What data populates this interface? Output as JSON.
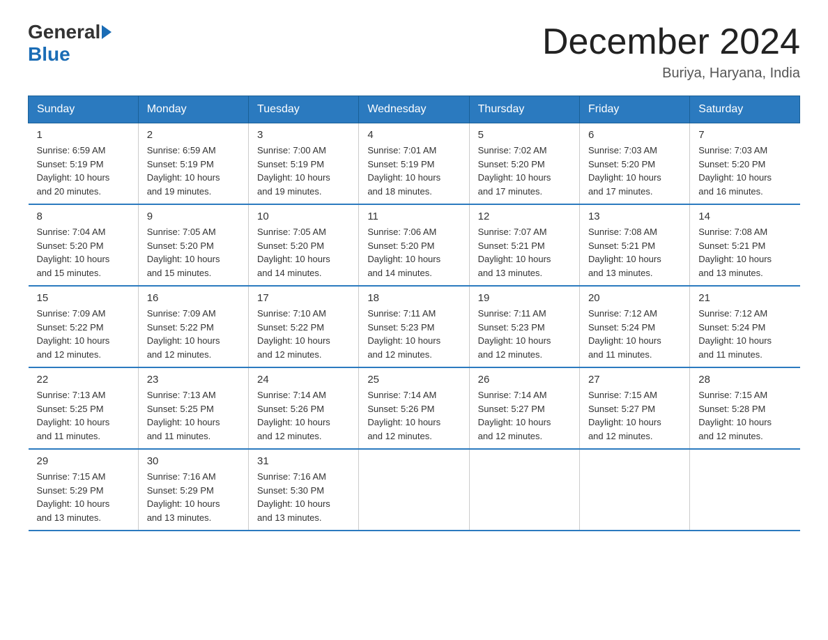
{
  "logo": {
    "general": "General",
    "blue": "Blue"
  },
  "title": "December 2024",
  "location": "Buriya, Haryana, India",
  "days_of_week": [
    "Sunday",
    "Monday",
    "Tuesday",
    "Wednesday",
    "Thursday",
    "Friday",
    "Saturday"
  ],
  "weeks": [
    [
      {
        "day": "1",
        "sunrise": "6:59 AM",
        "sunset": "5:19 PM",
        "daylight": "10 hours and 20 minutes."
      },
      {
        "day": "2",
        "sunrise": "6:59 AM",
        "sunset": "5:19 PM",
        "daylight": "10 hours and 19 minutes."
      },
      {
        "day": "3",
        "sunrise": "7:00 AM",
        "sunset": "5:19 PM",
        "daylight": "10 hours and 19 minutes."
      },
      {
        "day": "4",
        "sunrise": "7:01 AM",
        "sunset": "5:19 PM",
        "daylight": "10 hours and 18 minutes."
      },
      {
        "day": "5",
        "sunrise": "7:02 AM",
        "sunset": "5:20 PM",
        "daylight": "10 hours and 17 minutes."
      },
      {
        "day": "6",
        "sunrise": "7:03 AM",
        "sunset": "5:20 PM",
        "daylight": "10 hours and 17 minutes."
      },
      {
        "day": "7",
        "sunrise": "7:03 AM",
        "sunset": "5:20 PM",
        "daylight": "10 hours and 16 minutes."
      }
    ],
    [
      {
        "day": "8",
        "sunrise": "7:04 AM",
        "sunset": "5:20 PM",
        "daylight": "10 hours and 15 minutes."
      },
      {
        "day": "9",
        "sunrise": "7:05 AM",
        "sunset": "5:20 PM",
        "daylight": "10 hours and 15 minutes."
      },
      {
        "day": "10",
        "sunrise": "7:05 AM",
        "sunset": "5:20 PM",
        "daylight": "10 hours and 14 minutes."
      },
      {
        "day": "11",
        "sunrise": "7:06 AM",
        "sunset": "5:20 PM",
        "daylight": "10 hours and 14 minutes."
      },
      {
        "day": "12",
        "sunrise": "7:07 AM",
        "sunset": "5:21 PM",
        "daylight": "10 hours and 13 minutes."
      },
      {
        "day": "13",
        "sunrise": "7:08 AM",
        "sunset": "5:21 PM",
        "daylight": "10 hours and 13 minutes."
      },
      {
        "day": "14",
        "sunrise": "7:08 AM",
        "sunset": "5:21 PM",
        "daylight": "10 hours and 13 minutes."
      }
    ],
    [
      {
        "day": "15",
        "sunrise": "7:09 AM",
        "sunset": "5:22 PM",
        "daylight": "10 hours and 12 minutes."
      },
      {
        "day": "16",
        "sunrise": "7:09 AM",
        "sunset": "5:22 PM",
        "daylight": "10 hours and 12 minutes."
      },
      {
        "day": "17",
        "sunrise": "7:10 AM",
        "sunset": "5:22 PM",
        "daylight": "10 hours and 12 minutes."
      },
      {
        "day": "18",
        "sunrise": "7:11 AM",
        "sunset": "5:23 PM",
        "daylight": "10 hours and 12 minutes."
      },
      {
        "day": "19",
        "sunrise": "7:11 AM",
        "sunset": "5:23 PM",
        "daylight": "10 hours and 12 minutes."
      },
      {
        "day": "20",
        "sunrise": "7:12 AM",
        "sunset": "5:24 PM",
        "daylight": "10 hours and 11 minutes."
      },
      {
        "day": "21",
        "sunrise": "7:12 AM",
        "sunset": "5:24 PM",
        "daylight": "10 hours and 11 minutes."
      }
    ],
    [
      {
        "day": "22",
        "sunrise": "7:13 AM",
        "sunset": "5:25 PM",
        "daylight": "10 hours and 11 minutes."
      },
      {
        "day": "23",
        "sunrise": "7:13 AM",
        "sunset": "5:25 PM",
        "daylight": "10 hours and 11 minutes."
      },
      {
        "day": "24",
        "sunrise": "7:14 AM",
        "sunset": "5:26 PM",
        "daylight": "10 hours and 12 minutes."
      },
      {
        "day": "25",
        "sunrise": "7:14 AM",
        "sunset": "5:26 PM",
        "daylight": "10 hours and 12 minutes."
      },
      {
        "day": "26",
        "sunrise": "7:14 AM",
        "sunset": "5:27 PM",
        "daylight": "10 hours and 12 minutes."
      },
      {
        "day": "27",
        "sunrise": "7:15 AM",
        "sunset": "5:27 PM",
        "daylight": "10 hours and 12 minutes."
      },
      {
        "day": "28",
        "sunrise": "7:15 AM",
        "sunset": "5:28 PM",
        "daylight": "10 hours and 12 minutes."
      }
    ],
    [
      {
        "day": "29",
        "sunrise": "7:15 AM",
        "sunset": "5:29 PM",
        "daylight": "10 hours and 13 minutes."
      },
      {
        "day": "30",
        "sunrise": "7:16 AM",
        "sunset": "5:29 PM",
        "daylight": "10 hours and 13 minutes."
      },
      {
        "day": "31",
        "sunrise": "7:16 AM",
        "sunset": "5:30 PM",
        "daylight": "10 hours and 13 minutes."
      },
      null,
      null,
      null,
      null
    ]
  ],
  "labels": {
    "sunrise": "Sunrise:",
    "sunset": "Sunset:",
    "daylight": "Daylight:"
  }
}
